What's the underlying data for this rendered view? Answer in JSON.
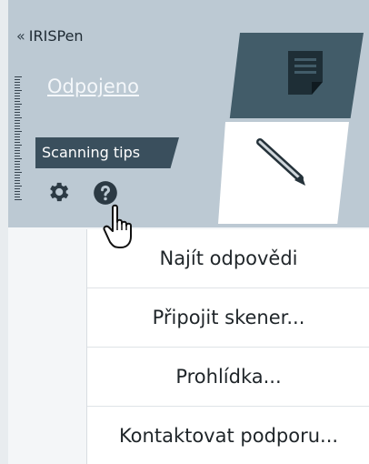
{
  "app": {
    "title": "IRISPen",
    "collapse_glyph": "«"
  },
  "status": {
    "connection": "Odpojeno"
  },
  "tips": {
    "label": "Scanning tips"
  },
  "icons": {
    "settings": "gear-icon",
    "help": "question-circle-icon",
    "scan_mode": "document-icon",
    "pen_mode": "pen-icon",
    "cursor": "hand-pointer-cursor"
  },
  "menu": {
    "items": [
      {
        "label": "Najít odpovědi"
      },
      {
        "label": "Připojit skener..."
      },
      {
        "label": "Prohlídka..."
      },
      {
        "label": "Kontaktovat podporu..."
      }
    ]
  },
  "colors": {
    "panel": "#bcc9d3",
    "accent_dark": "#3a4f5d",
    "mode_active": "#425c69",
    "link": "#f4f7fa"
  }
}
